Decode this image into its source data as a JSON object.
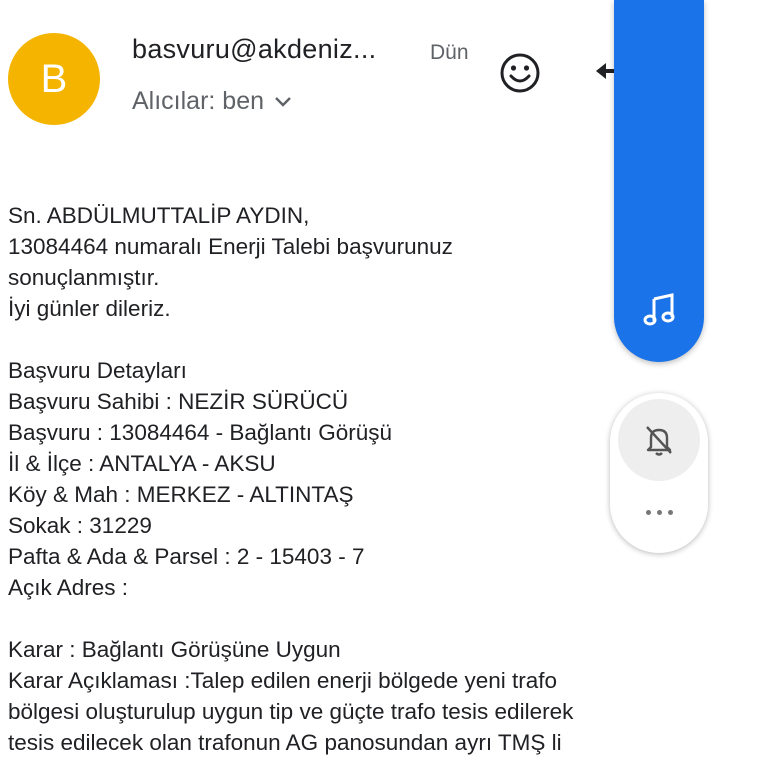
{
  "header": {
    "avatar_letter": "B",
    "avatar_color": "#F4B400",
    "sender": "basvuru@akdeniz...",
    "date": "Dün",
    "recipients_label": "Alıcılar: ben",
    "icons": {
      "emoji": "smiley-icon",
      "reply": "reply-icon",
      "expand": "chevron-down-icon"
    }
  },
  "body": {
    "lines": [
      "Sn. ABDÜLMUTTALİP AYDIN,",
      "13084464 numaralı Enerji Talebi başvurunuz",
      "sonuçlanmıştır.",
      "İyi günler dileriz.",
      "",
      "Başvuru Detayları",
      "Başvuru Sahibi : NEZİR SÜRÜCÜ",
      "Başvuru : 13084464 - Bağlantı Görüşü",
      "İl & İlçe : ANTALYA - AKSU",
      "Köy & Mah : MERKEZ - ALTINTAŞ",
      "Sokak : 31229",
      "Pafta & Ada & Parsel : 2 - 15403 - 7",
      "Açık Adres :",
      "",
      "Karar : Bağlantı Görüşüne Uygun",
      "Karar Açıklaması :Talep edilen enerji bölgede yeni trafo",
      "bölgesi oluşturulup  uygun tip ve güçte trafo tesis edilerek",
      "tesis edilecek olan trafonun AG panosundan ayrı TMŞ li"
    ]
  },
  "volume_panel": {
    "accent_color": "#1A73E8",
    "icons": {
      "media": "music-note-icon",
      "ringer": "bell-off-icon",
      "more": "more-horizontal-icon"
    }
  }
}
